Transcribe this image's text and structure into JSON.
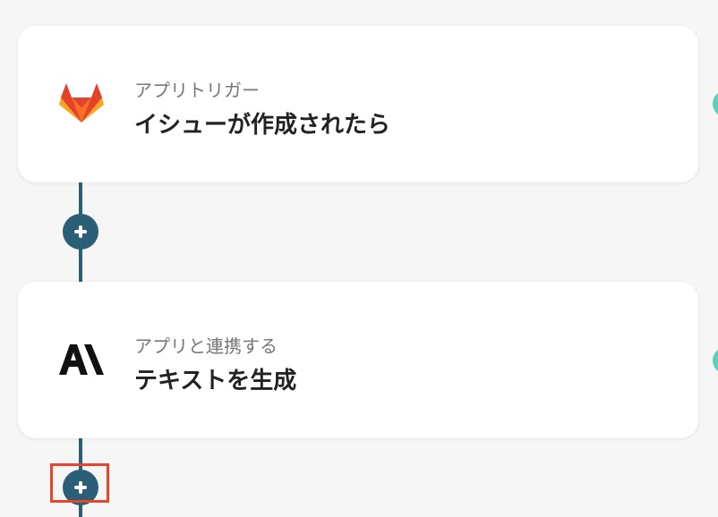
{
  "flow": {
    "steps": [
      {
        "subtitle": "アプリトリガー",
        "title": "イシューが作成されたら",
        "icon": "gitlab-icon"
      },
      {
        "subtitle": "アプリと連携する",
        "title": "テキストを生成",
        "icon": "anthropic-icon"
      }
    ],
    "add_buttons": [
      "add-step-button-1",
      "add-step-button-2"
    ]
  },
  "colors": {
    "connector": "#2b5f78",
    "highlight": "#e8452c",
    "side_dot": "#5ccfc0",
    "gitlab_orange": "#e24329",
    "gitlab_light": "#fc6d26",
    "gitlab_yellow": "#fca326"
  }
}
